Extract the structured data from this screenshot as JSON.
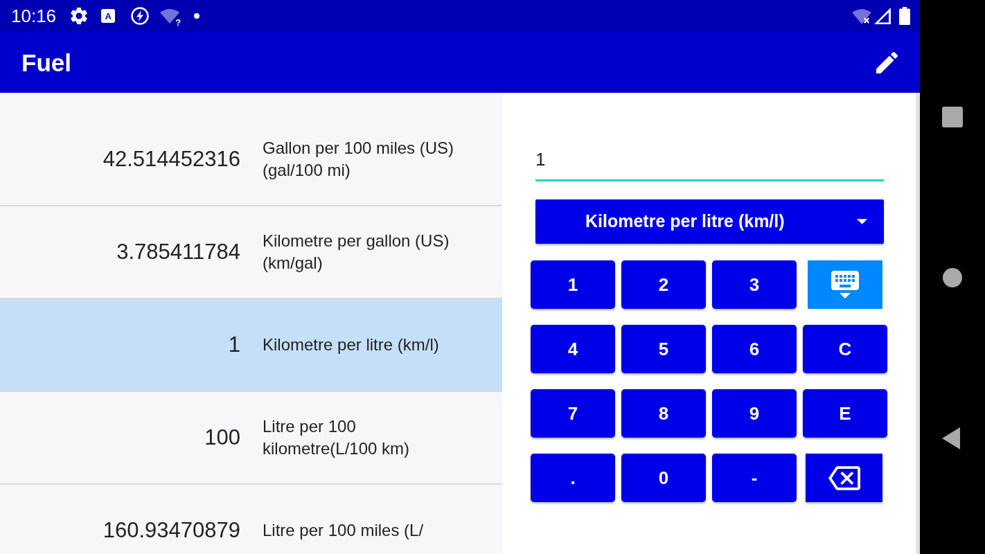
{
  "status_bar": {
    "time": "10:16",
    "input_tile": "A",
    "wifi_mark": "?"
  },
  "app_bar": {
    "title": "Fuel"
  },
  "results": [
    {
      "value": "42.514452316",
      "unit": "Gallon per 100 miles (US) (gal/100 mi)",
      "selected": false
    },
    {
      "value": "3.785411784",
      "unit": "Kilometre per gallon (US) (km/gal)",
      "selected": false
    },
    {
      "value": "1",
      "unit": "Kilometre per litre (km/l)",
      "selected": true
    },
    {
      "value": "100",
      "unit": "Litre per 100 kilometre(L/100 km)",
      "selected": false
    },
    {
      "value": "160.93470879",
      "unit": "Litre per 100 miles (L/",
      "selected": false
    }
  ],
  "converter": {
    "input": {
      "value": "1"
    },
    "unit_dropdown": {
      "label": "Kilometre per litre (km/l)"
    },
    "keys": [
      {
        "kind": "char",
        "label": "1"
      },
      {
        "kind": "char",
        "label": "2"
      },
      {
        "kind": "char",
        "label": "3"
      },
      {
        "kind": "keyboard"
      },
      {
        "kind": "char",
        "label": "4"
      },
      {
        "kind": "char",
        "label": "5"
      },
      {
        "kind": "char",
        "label": "6"
      },
      {
        "kind": "char",
        "label": "C"
      },
      {
        "kind": "char",
        "label": "7"
      },
      {
        "kind": "char",
        "label": "8"
      },
      {
        "kind": "char",
        "label": "9"
      },
      {
        "kind": "char",
        "label": "E"
      },
      {
        "kind": "char",
        "label": "."
      },
      {
        "kind": "char",
        "label": "0"
      },
      {
        "kind": "char",
        "label": "-"
      },
      {
        "kind": "backspace"
      }
    ]
  }
}
